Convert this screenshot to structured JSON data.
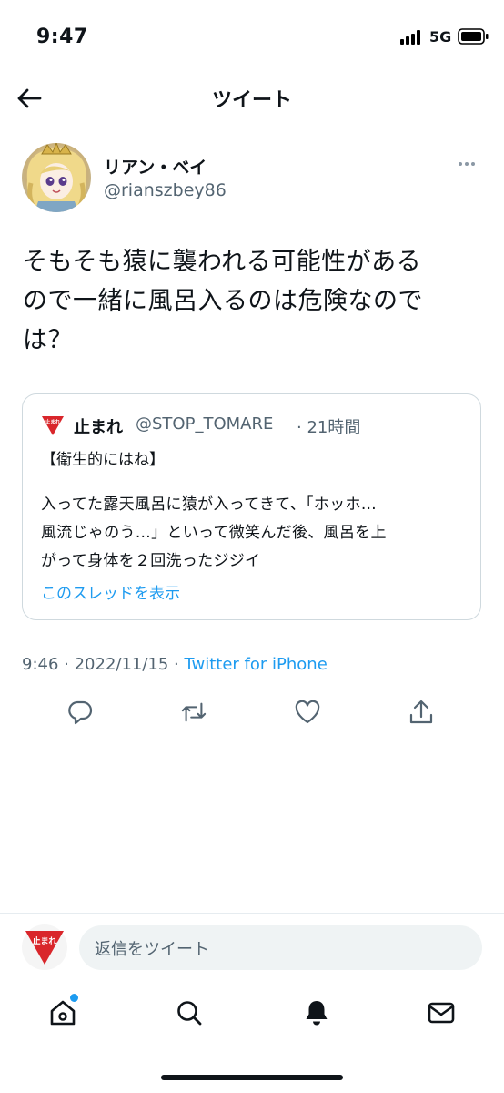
{
  "status_bar": {
    "time": "9:47",
    "network": "5G"
  },
  "header": {
    "title": "ツイート"
  },
  "tweet": {
    "display_name": "リアン・ベイ",
    "handle": "@rianszbey86",
    "lines": [
      "そもそも猿に襲われる可能性がある",
      "ので一緒に風呂入るのは危険なので",
      "は？"
    ],
    "meta_time": "9:46 · 2022/11/15 · ",
    "meta_source": "Twitter for iPhone"
  },
  "quote": {
    "name": "止まれ",
    "handle": "@STOP_TOMARE",
    "time": "· 21時間",
    "title": "【衛生的にはね】",
    "lines": [
      "入ってた露天風呂に猿が入ってきて、「ホッホ…",
      "風流じゃのう…」といって微笑んだ後、風呂を上",
      "がって身体を２回洗ったジジイ"
    ],
    "show_thread": "このスレッドを表示",
    "icon_text": "止まれ"
  },
  "reply": {
    "placeholder": "返信をツイート",
    "avatar_text": "止まれ"
  },
  "colors": {
    "accent": "#1d9bf0",
    "secondary_text": "#536471",
    "stop_sign": "#d9262b"
  },
  "icons": {
    "back": "arrow-left-icon",
    "more": "more-dots-icon",
    "reply": "reply-icon",
    "retweet": "retweet-icon",
    "like": "heart-icon",
    "share": "share-icon",
    "home": "home-icon",
    "search": "search-icon",
    "notifications": "bell-icon",
    "messages": "mail-icon"
  }
}
